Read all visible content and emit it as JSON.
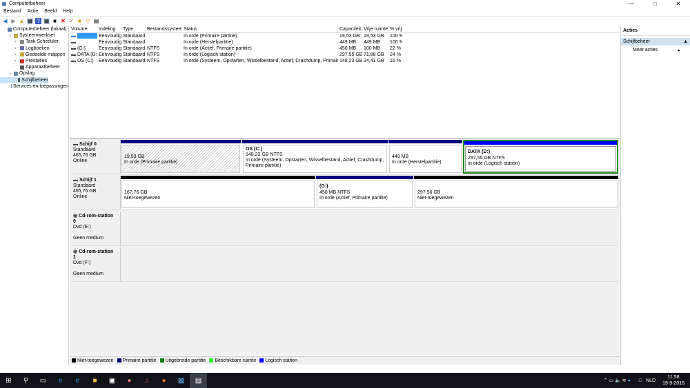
{
  "window": {
    "title": "Computerbeheer"
  },
  "menu": [
    "Bestand",
    "Actie",
    "Beeld",
    "Help"
  ],
  "tree": [
    {
      "label": "Computerbeheer (lokaal)",
      "level": 0,
      "color": "#5b7fb0"
    },
    {
      "label": "Systeemwerkset",
      "level": 1,
      "color": "#c9a33d"
    },
    {
      "label": "Task Scheduler",
      "level": 2,
      "color": "#888"
    },
    {
      "label": "Logboeken",
      "level": 2,
      "color": "#6b6bb0"
    },
    {
      "label": "Gedeelde mappen",
      "level": 2,
      "color": "#c9a33d"
    },
    {
      "label": "Prestaties",
      "level": 2,
      "color": "#c33"
    },
    {
      "label": "Apparaatbeheer",
      "level": 2,
      "color": "#555"
    },
    {
      "label": "Opslag",
      "level": 1,
      "color": "#6a8aa8"
    },
    {
      "label": "Schijfbeheer",
      "level": 2,
      "color": "#555",
      "selected": true
    },
    {
      "label": "Services en toepassingen",
      "level": 1,
      "color": "#6a8aa8"
    }
  ],
  "table": {
    "columns": [
      "Volume",
      "Indeling",
      "Type",
      "Bestandssysteem",
      "Status",
      "Capaciteit",
      "Vrije ruimte",
      "% vrij"
    ],
    "rows": [
      [
        "",
        "Eenvoudig",
        "Standaard",
        "",
        "In orde (Primaire partitie)",
        "19,53 GB",
        "19,53 GB",
        "100 %"
      ],
      [
        "",
        "Eenvoudig",
        "Standaard",
        "",
        "In orde (Herstelpartitie)",
        "449 MB",
        "449 MB",
        "100 %"
      ],
      [
        "(G:)",
        "Eenvoudig",
        "Standaard",
        "NTFS",
        "In orde (Actief, Primaire partitie)",
        "450 MB",
        "100 MB",
        "22 %"
      ],
      [
        "DATA (D:)",
        "Eenvoudig",
        "Standaard",
        "NTFS",
        "In orde (Logisch station)",
        "297,55 GB",
        "71,88 GB",
        "24 %"
      ],
      [
        "OS (C:)",
        "Eenvoudig",
        "Standaard",
        "NTFS",
        "In orde (Systeem, Opstarten, Wisselbestand, Actief, Crashdump, Primaire partitie)",
        "148,23 GB",
        "24,41 GB",
        "16 %"
      ]
    ]
  },
  "disks": [
    {
      "name": "Schijf 0",
      "type": "Standaard",
      "size": "465,76 GB",
      "state": "Online"
    },
    {
      "name": "Schijf 1",
      "type": "Standaard",
      "size": "465,76 GB",
      "state": "Online"
    },
    {
      "name": "Cd-rom-station 0",
      "type": "Dvd (E:)",
      "state": "Geen medium"
    },
    {
      "name": "Cd-rom-station 1",
      "type": "Dvd (F:)",
      "state": "Geen medium"
    }
  ],
  "partitions": {
    "d0p1": {
      "size": "19,53 GB",
      "status": "In orde (Primaire partitie)"
    },
    "d0p2": {
      "name": "OS  (C:)",
      "size": "148,23 GB NTFS",
      "status": "In orde (Systeem, Opstarten, Wisselbestand, Actief, Crashdump, Primaire partitie)"
    },
    "d0p3": {
      "size": "449 MB",
      "status": "In orde (Herstelpartitie)"
    },
    "d0p4": {
      "name": "DATA  (D:)",
      "size": "297,55 GB NTFS",
      "status": "In orde (Logisch station)"
    },
    "d1p1": {
      "size": "167,76 GB",
      "status": "Niet-toegewezen"
    },
    "d1p2": {
      "name": "(G:)",
      "size": "450 MB NTFS",
      "status": "In orde (Actief, Primaire partitie)"
    },
    "d1p3": {
      "size": "297,56 GB",
      "status": "Niet-toegewezen"
    }
  },
  "legend": [
    {
      "label": "Niet-toegewezen",
      "color": "#000000"
    },
    {
      "label": "Primaire partitie",
      "color": "#000080"
    },
    {
      "label": "Uitgebreide partitie",
      "color": "#008000"
    },
    {
      "label": "Beschikbare ruimte",
      "color": "#33ee33"
    },
    {
      "label": "Logisch station",
      "color": "#0000ff"
    }
  ],
  "actions": {
    "title": "Acties",
    "section": "Schijfbeheer",
    "more": "Meer acties"
  },
  "taskbar": {
    "lang": "NLD",
    "time": "11:58",
    "date": "19-9-2016"
  }
}
